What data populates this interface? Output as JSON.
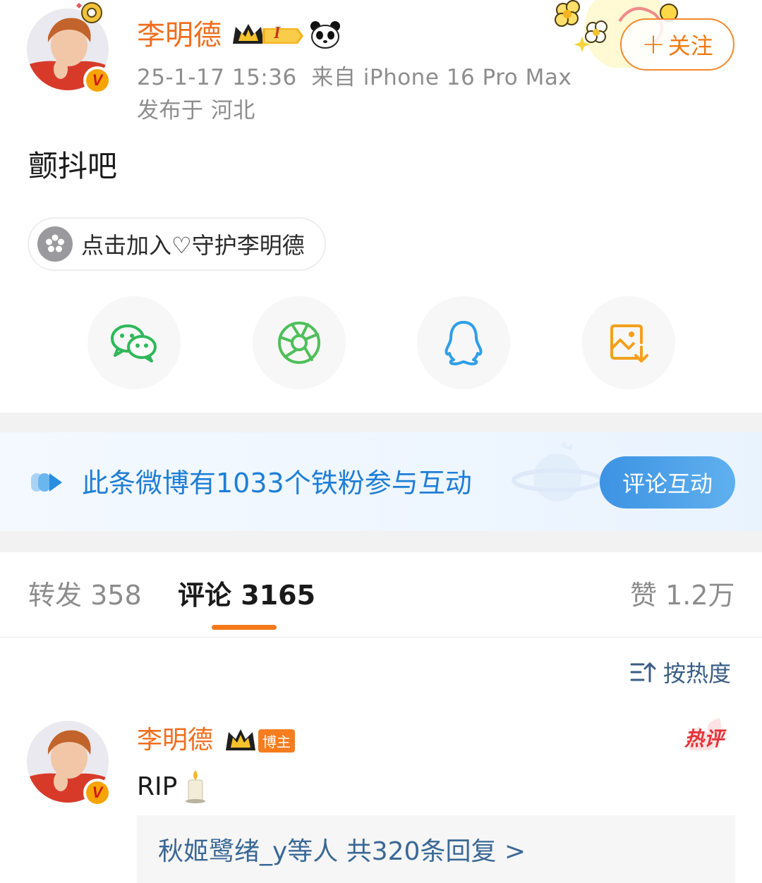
{
  "post": {
    "author": "李明德",
    "timestamp": "25-1-17 15:36",
    "source": "来自 iPhone 16 Pro Max",
    "location": "发布于 河北",
    "text": "颤抖吧",
    "follow_label": "关注",
    "follow_plus": "+",
    "level_badge": "I",
    "guard_label": "点击加入♡守护李明德",
    "verified": "V"
  },
  "share": {
    "items": [
      "wechat-icon",
      "moments-icon",
      "qq-icon",
      "save-image-icon"
    ],
    "colors": {
      "wechat": "#2fb85a",
      "moments": "#4fbf59",
      "qq": "#2f9ee8",
      "save": "#f3a01d"
    }
  },
  "fans_banner": {
    "text": "此条微博有1033个铁粉参与互动",
    "button": "评论互动"
  },
  "tabs": {
    "repost_label": "转发",
    "repost_count": "358",
    "comment_label": "评论",
    "comment_count": "3165",
    "like_label": "赞",
    "like_count": "1.2万"
  },
  "sort": {
    "label": "按热度"
  },
  "comment": {
    "author": "李明德",
    "author_tag": "博主",
    "text": "RIP",
    "hot_label": "热评",
    "replies": "秋姬鹭绪_y等人 共320条回复 >"
  },
  "colors": {
    "accent_orange": "#f16d1c",
    "link_blue": "#1f7fd6",
    "reply_blue": "#3a6896"
  }
}
